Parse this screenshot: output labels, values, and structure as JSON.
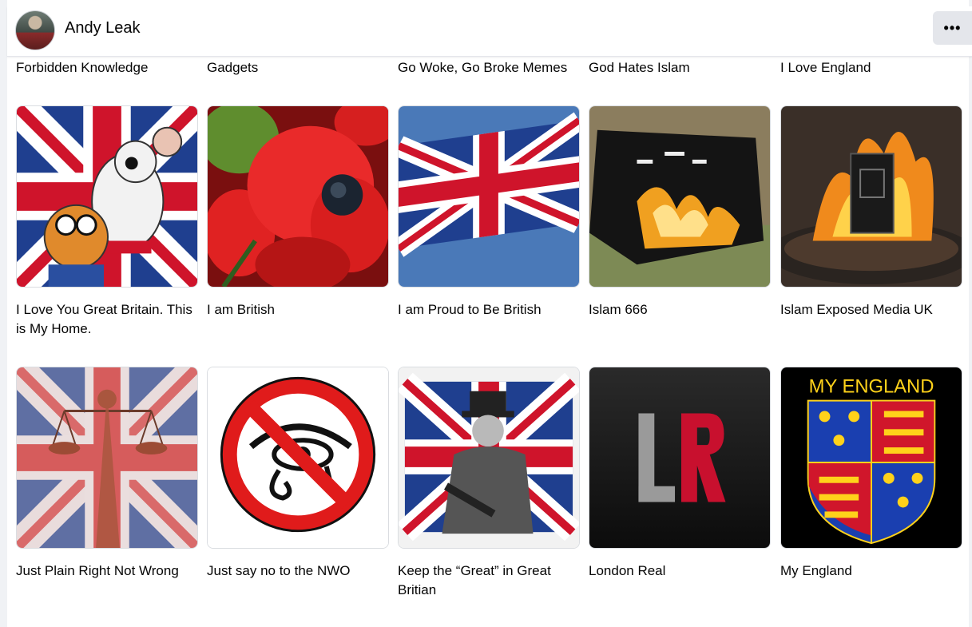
{
  "header": {
    "user_name": "Andy Leak",
    "more_button_label": "•••"
  },
  "pages_top_row": [
    "Forbidden Knowledge",
    "Gadgets",
    "Go Woke, Go Broke Memes",
    "God Hates Islam",
    "I Love England"
  ],
  "pages": [
    {
      "name": "I Love You Great Britain. This is My Home.",
      "image": "danger-mouse-union-jack"
    },
    {
      "name": "I am British",
      "image": "red-poppy"
    },
    {
      "name": "I am Proud to Be British",
      "image": "union-jack-flag-waving"
    },
    {
      "name": "Islam 666",
      "image": "burning-black-flag"
    },
    {
      "name": "Islam Exposed Media UK",
      "image": "burning-book"
    },
    {
      "name": "Just Plain Right Not Wrong",
      "image": "lady-justice-union-jack"
    },
    {
      "name": "Just say no to the NWO",
      "image": "no-eye-of-horus-sign"
    },
    {
      "name": "Keep the “Great” in Great Britian",
      "image": "churchill-union-jack"
    },
    {
      "name": "London Real",
      "image": "lr-logo",
      "logo_text": "LR"
    },
    {
      "name": "My England",
      "image": "royal-arms-england",
      "banner_text": "MY ENGLAND"
    }
  ],
  "colors": {
    "union_red": "#cf142b",
    "union_blue": "#1f3f8f",
    "lr_red": "#c8102e",
    "panel_bg": "#f0f2f5",
    "button_bg": "#e4e6eb"
  }
}
